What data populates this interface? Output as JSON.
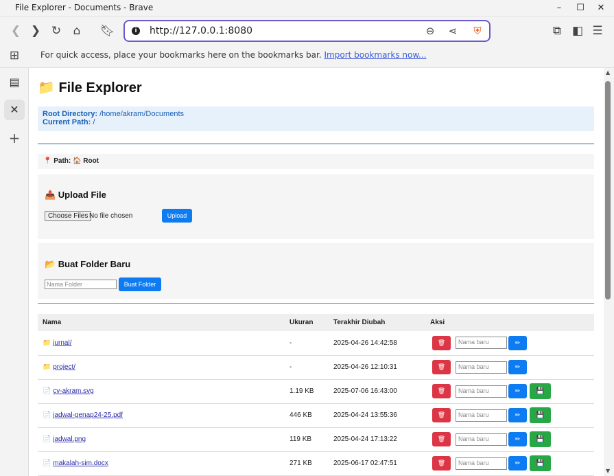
{
  "window": {
    "title": "File Explorer - Documents - Brave"
  },
  "browser": {
    "url": "http://127.0.0.1:8080",
    "bookmarks_msg": "For quick access, place your bookmarks here on the bookmarks bar.",
    "bookmarks_link": "Import bookmarks now..."
  },
  "page": {
    "title": "File Explorer",
    "title_icon": "📁",
    "root_label": "Root Directory:",
    "root_value": "/home/akram/Documents",
    "current_label": "Current Path:",
    "current_value": "/",
    "path_text": "📍 Path: 🏠 Root",
    "upload": {
      "heading": "📤 Upload File",
      "choose_label": "Choose Files",
      "nofile": "No file chosen",
      "button": "Upload"
    },
    "folder": {
      "heading": "📂 Buat Folder Baru",
      "placeholder": "Nama Folder",
      "button": "Buat Folder"
    },
    "table": {
      "headers": [
        "Nama",
        "Ukuran",
        "Terakhir Diubah",
        "Aksi"
      ],
      "rename_placeholder": "Nama baru",
      "rows": [
        {
          "icon": "📁",
          "name": "jurnal/",
          "size": "-",
          "modified": "2025-04-26 14:42:58",
          "download": false
        },
        {
          "icon": "📁",
          "name": "project/",
          "size": "-",
          "modified": "2025-04-26 12:10:31",
          "download": false
        },
        {
          "icon": "📄",
          "name": "cv-akram.svg",
          "size": "1.19 KB",
          "modified": "2025-07-06 16:43:00",
          "download": true
        },
        {
          "icon": "📄",
          "name": "jadwal-genap24-25.pdf",
          "size": "446 KB",
          "modified": "2025-04-24 13:55:36",
          "download": true
        },
        {
          "icon": "📄",
          "name": "jadwal.png",
          "size": "119 KB",
          "modified": "2025-04-24 17:13:22",
          "download": true
        },
        {
          "icon": "📄",
          "name": "makalah-sim.docx",
          "size": "271 KB",
          "modified": "2025-06-17 02:47:51",
          "download": true
        }
      ]
    }
  }
}
